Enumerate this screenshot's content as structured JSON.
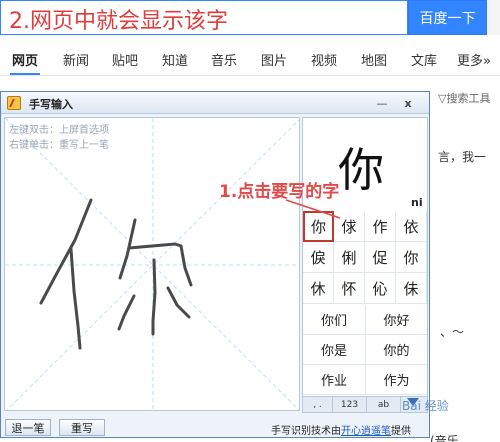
{
  "search": {
    "query": "2.网页中就会显示该字",
    "button_label": "百度一下"
  },
  "nav": {
    "items": [
      "网页",
      "新闻",
      "贴吧",
      "知道",
      "音乐",
      "图片",
      "视频",
      "地图",
      "文库",
      "更多»"
    ],
    "active": "网页"
  },
  "page": {
    "search_tools_label": "▽搜索工具",
    "fragments": {
      "frag1": "言，我一",
      "frag2": "、～",
      "frag3": "(音乐"
    }
  },
  "handwriting": {
    "title": "手写输入",
    "minimize": "—",
    "close": "x",
    "hint_left": "左键双击：上屏首选项",
    "hint_right": "右键单击：重写上一笔",
    "preview_char": "你",
    "pinyin": "ni",
    "candidates": [
      "你",
      "俅",
      "作",
      "依",
      "㑦",
      "俐",
      "促",
      "你",
      "休",
      "怀",
      "伈",
      "佅"
    ],
    "selected_candidate_index": 0,
    "words": [
      "你们",
      "你好",
      "你是",
      "你的",
      "作业",
      "作为"
    ],
    "toolbar": {
      "punct": ", .",
      "digits": "123",
      "alpha": "ab"
    },
    "undo_label": "退一笔",
    "rewrite_label": "重写",
    "credit_prefix": "手写识别技术由",
    "credit_link": "开心逍遥笔",
    "credit_suffix": "提供"
  },
  "annotations": {
    "top": "2.网页中就会显示该字",
    "step1": "1.点击要写的字"
  },
  "watermark": "Bai 经验",
  "colors": {
    "annotation_red": "#e24a4a",
    "baidu_blue": "#3385ff",
    "selection_red": "#c0392b"
  }
}
